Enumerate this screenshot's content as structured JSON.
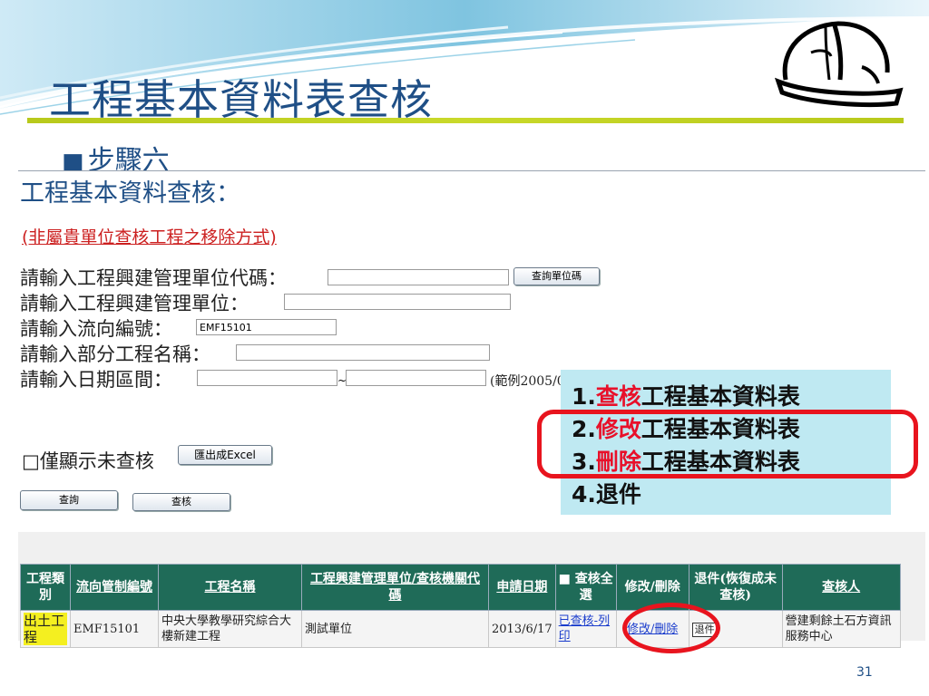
{
  "slide": {
    "title": "工程基本資料表查核",
    "step": "步驟六",
    "page_number": "31"
  },
  "screen": {
    "heading": "工程基本資料查核：",
    "notice": "(非屬貴單位查核工程之移除方式)",
    "form": {
      "unit_code_label": "請輸入工程興建管理單位代碼：",
      "unit_code_value": "",
      "query_unit_button": "查詢單位碼",
      "unit_label": "請輸入工程興建管理單位：",
      "unit_value": "",
      "flow_label": "請輸入流向編號：",
      "flow_value": "EMF15101",
      "partial_name_label": "請輸入部分工程名稱：",
      "partial_name_value": "",
      "date_label": "請輸入日期區間：",
      "date_start": "",
      "date_sep": "~",
      "date_end": "",
      "date_example": "(範例2005/0",
      "unreviewed_checkbox": "□",
      "unreviewed_label": "僅顯示未查核",
      "export_button": "匯出成Excel",
      "query_button": "查詢",
      "review_button": "查核"
    },
    "callout": {
      "items": [
        {
          "num": "1.",
          "verb": "查核",
          "rest": "工程基本資料表"
        },
        {
          "num": "2.",
          "verb": "修改",
          "rest": "工程基本資料表"
        },
        {
          "num": "3.",
          "verb": "刪除",
          "rest": "工程基本資料表"
        },
        {
          "num": "4.",
          "verb": "",
          "rest": "退件"
        }
      ]
    },
    "table": {
      "headers": {
        "category": "工程類別",
        "flow_no": "流向管制編號",
        "name": "工程名稱",
        "unit": "工程興建管理單位/查核機關代碼",
        "date": "申請日期",
        "select_all_box": "■",
        "select_all": "查核全選",
        "edit_delete": "修改/刪除",
        "return": "退件(恢復成未查核)",
        "reviewer": "查核人"
      },
      "row": {
        "category": "出土工程",
        "flow_no": "EMF15101",
        "name": "中央大學教學研究綜合大樓新建工程",
        "unit": "測試單位",
        "date": "2013/6/17",
        "reviewed_print": "已查核-列印",
        "edit_delete": "修改/刪除",
        "return_button": "退件",
        "reviewer": "營建剩餘土石方資訊服務中心"
      }
    }
  },
  "colors": {
    "title_blue": "#1f4f86",
    "accent_line": "#b8c91b",
    "header_green": "#1f6b58",
    "highlight_red": "#e8141e",
    "callout_bg": "#bfe9f2"
  }
}
